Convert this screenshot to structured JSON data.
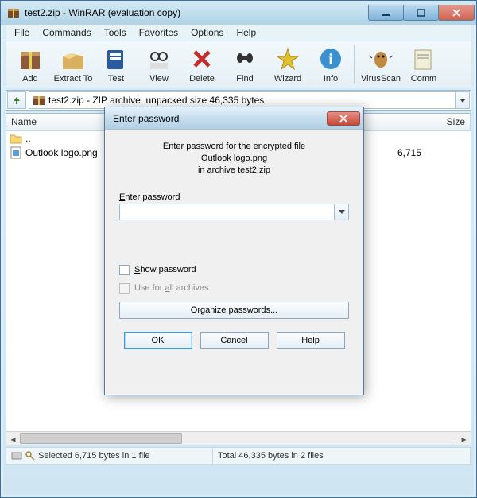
{
  "window": {
    "title": "test2.zip - WinRAR (evaluation copy)"
  },
  "menu": {
    "file": "File",
    "commands": "Commands",
    "tools": "Tools",
    "favorites": "Favorites",
    "options": "Options",
    "help": "Help"
  },
  "toolbar": {
    "add": "Add",
    "extract": "Extract To",
    "test": "Test",
    "view": "View",
    "delete": "Delete",
    "find": "Find",
    "wizard": "Wizard",
    "info": "Info",
    "virusscan": "VirusScan",
    "comment": "Comm"
  },
  "address": {
    "text": "test2.zip - ZIP archive, unpacked size 46,335 bytes"
  },
  "columns": {
    "name": "Name",
    "size": "Size"
  },
  "rows": {
    "updir": "..",
    "file1_name": "Outlook logo.png",
    "file1_size": "6,715"
  },
  "status": {
    "left": "Selected 6,715 bytes in 1 file",
    "right": "Total 46,335 bytes in 2 files"
  },
  "dialog": {
    "title": "Enter password",
    "msg_l1": "Enter password for the encrypted file",
    "msg_l2": "Outlook logo.png",
    "msg_l3": "in archive test2.zip",
    "field_label": "Enter password",
    "show_password": "Show password",
    "use_all": "Use for all archives",
    "organize": "Organize passwords...",
    "ok": "OK",
    "cancel": "Cancel",
    "help": "Help"
  }
}
